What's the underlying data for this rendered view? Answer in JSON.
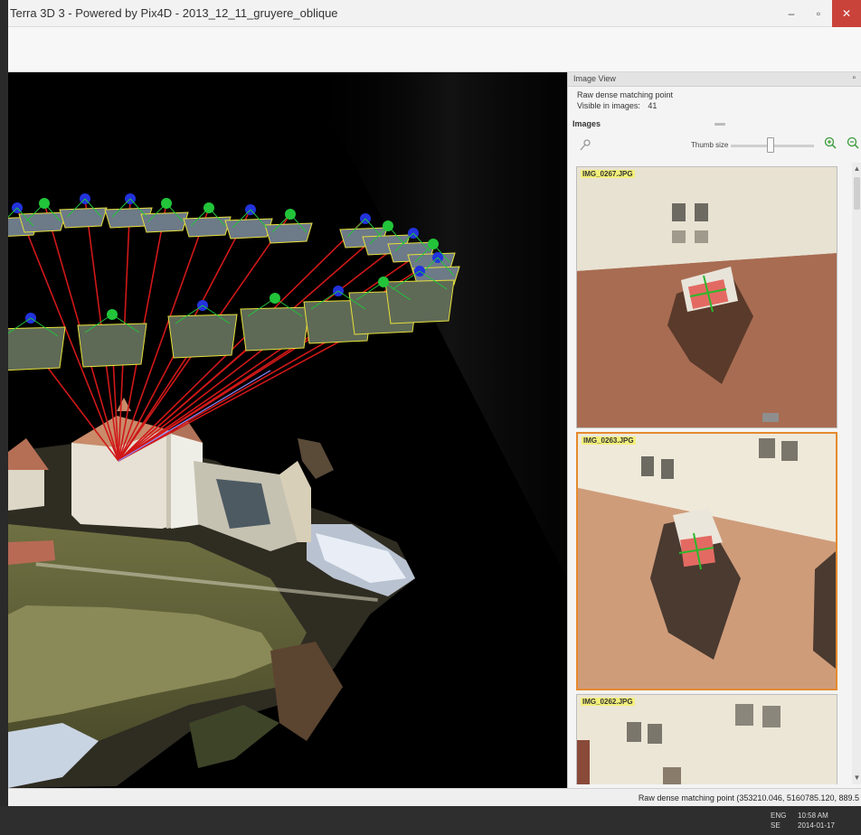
{
  "window": {
    "title": "Terra 3D 3 - Powered by Pix4D - 2013_12_11_gruyere_oblique",
    "minimize_glyph": "–",
    "maximize_glyph": "▫",
    "close_glyph": "✕"
  },
  "image_view": {
    "header": "Image View",
    "float_glyph": "▫",
    "point_type": "Raw dense matching point",
    "visible_label": "Visible in images:",
    "visible_count": "41"
  },
  "images": {
    "title": "Images",
    "thumb_size_label": "Thumb size",
    "thumbnails": [
      {
        "name": "IMG_0267.JPG",
        "selected": false
      },
      {
        "name": "IMG_0263.JPG",
        "selected": true
      },
      {
        "name": "IMG_0262.JPG",
        "selected": false
      }
    ]
  },
  "status": {
    "message": "Raw dense matching point (353210.046, 5160785.120, 889.5"
  },
  "taskbar": {
    "lang": "ENG",
    "region": "SE",
    "time": "10:58 AM",
    "date": "2014-01-17"
  },
  "colors": {
    "selected_border": "#e58a2f",
    "ray_color": "#d01818",
    "camera_green": "#22c43a",
    "camera_blue": "#2233dd",
    "frame_yellow": "#e8e03a"
  },
  "icons": {
    "pin": "pin-icon",
    "zoom_in": "zoom-in-icon",
    "zoom_out": "zoom-out-icon"
  }
}
